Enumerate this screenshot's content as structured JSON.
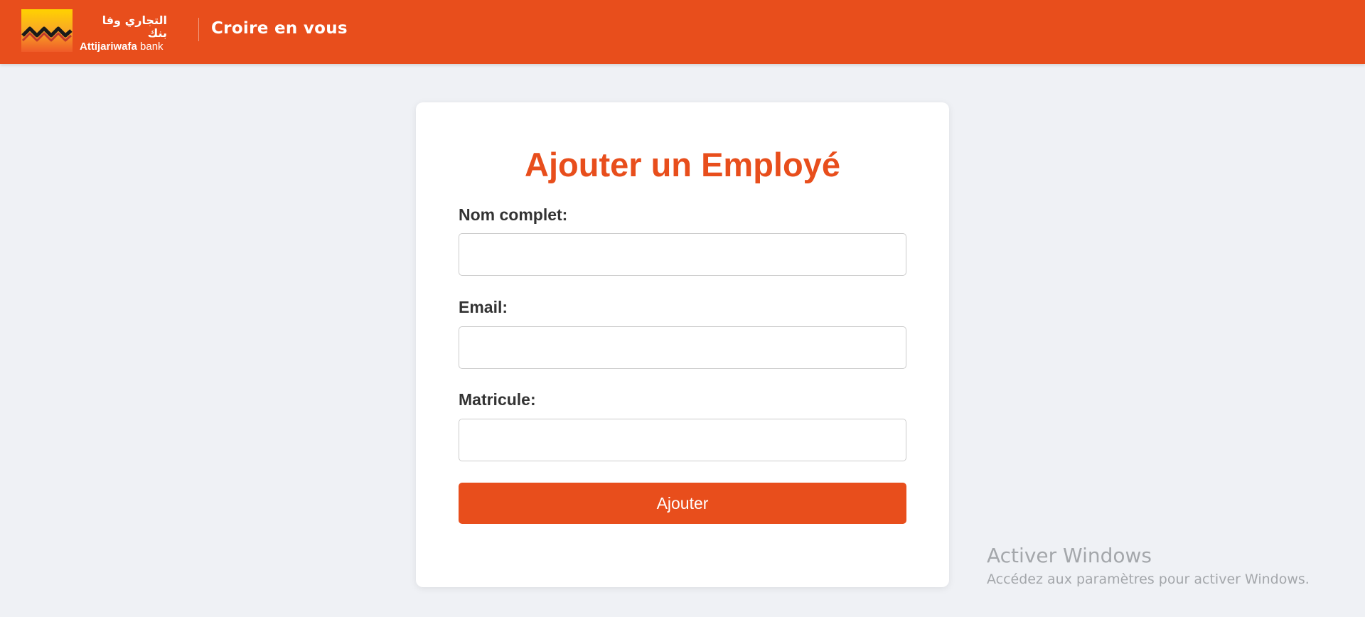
{
  "header": {
    "brand_arabic": "التجاري وفا بنك",
    "brand_latin_bold": "Attijariwafa",
    "brand_latin_regular": " bank",
    "tagline": "Croire en vous",
    "background_color": "#e84e1c",
    "logo_icon": "attijariwafa-logo-icon"
  },
  "form": {
    "title": "Ajouter un Employé",
    "fields": [
      {
        "label": "Nom complet:",
        "value": "",
        "placeholder": ""
      },
      {
        "label": "Email:",
        "value": "",
        "placeholder": ""
      },
      {
        "label": "Matricule:",
        "value": "",
        "placeholder": ""
      }
    ],
    "submit_label": "Ajouter",
    "accent_color": "#e84e1c"
  },
  "watermark": {
    "title": "Activer Windows",
    "subtitle": "Accédez aux paramètres pour activer Windows."
  }
}
